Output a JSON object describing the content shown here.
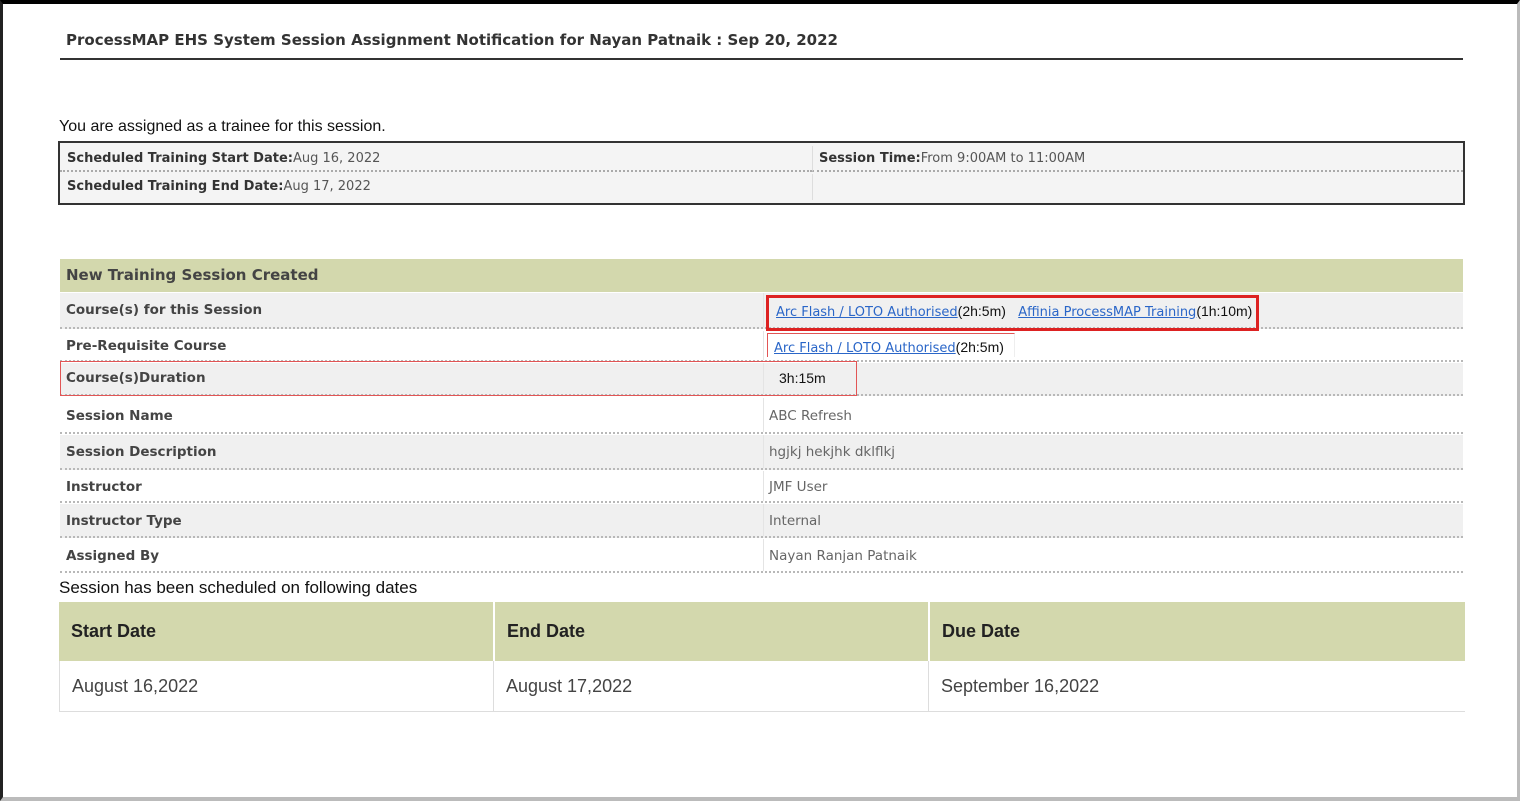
{
  "notification": {
    "title": "ProcessMAP EHS System Session Assignment Notification for Nayan Patnaik : Sep 20, 2022"
  },
  "assignment": {
    "message": "You are assigned as a trainee for this session.",
    "start_label": "Scheduled Training Start Date:",
    "start_value": "Aug 16, 2022",
    "end_label": "Scheduled Training End Date:",
    "end_value": "Aug 17, 2022",
    "time_label": "Session Time:",
    "time_value": "From 9:00AM to 11:00AM"
  },
  "session": {
    "header": "New Training Session Created",
    "courses_label": "Course(s) for this Session",
    "courses": [
      {
        "name": "Arc Flash / LOTO Authorised",
        "duration": "(2h:5m)"
      },
      {
        "name": "Affinia ProcessMAP Training",
        "duration": "(1h:10m)"
      }
    ],
    "prereq_label": "Pre-Requisite Course",
    "prereq": {
      "name": "Arc Flash / LOTO Authorised",
      "duration": "(2h:5m)"
    },
    "duration_label": "Course(s)Duration",
    "duration_value": "3h:15m",
    "name_label": "Session Name",
    "name_value": "ABC Refresh",
    "description_label": "Session Description",
    "description_value": "hgjkj hekjhk dklflkj",
    "instructor_label": "Instructor",
    "instructor_value": "JMF User",
    "instructor_type_label": "Instructor Type",
    "instructor_type_value": "Internal",
    "assigned_by_label": "Assigned By",
    "assigned_by_value": "Nayan Ranjan Patnaik"
  },
  "schedule": {
    "caption": "Session has been scheduled on following dates",
    "headers": [
      "Start Date",
      "End Date",
      "Due Date"
    ],
    "rows": [
      [
        "August 16,2022",
        "August 17,2022",
        "September 16,2022"
      ]
    ]
  },
  "colors": {
    "header_band": "#d3d8ad",
    "link": "#2a66c8",
    "highlight": "#d22222"
  }
}
